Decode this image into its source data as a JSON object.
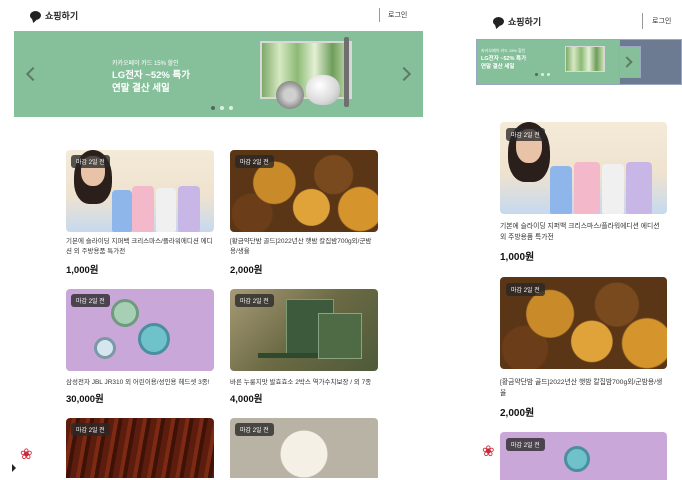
{
  "header": {
    "title": "쇼핑하기",
    "login_label": "로그인"
  },
  "banner": {
    "eyebrow": "카카오페이 카드 15% 할인",
    "title_line1": "LG전자 ~52% 특가",
    "title_line2": "연말 결산 세일",
    "dots": 3,
    "active_dot": 0,
    "color": "#86c09a"
  },
  "products": [
    {
      "badge": "마감 2일 전",
      "description": "기본에 슬라이딩 지퍼백 크리스마스/플라워에디션 에디션 외 주방용품 특가전",
      "price": "1,000원"
    },
    {
      "badge": "마감 2일 전",
      "description": "[황금약단밤 골드]2022년산 햇밤 칼집밤700g외/군밤용/생율",
      "price": "2,000원"
    },
    {
      "badge": "마감 2일 전",
      "description": "삼성전자 JBL JR310 외 어린이용/성인용 헤드셋 3종!",
      "price": "30,000원"
    },
    {
      "badge": "마감 2일 전",
      "description": "바른 누룽지맛 발효효소 2박스 역가수치보장 / 외 7종",
      "price": "4,000원"
    },
    {
      "badge": "마감 2일 전"
    },
    {
      "badge": "마감 2일 전"
    }
  ],
  "icons": {
    "brand": "chat-bubble-icon",
    "floating": "flower-icon",
    "prev": "chevron-left-icon",
    "next": "chevron-right-icon"
  }
}
